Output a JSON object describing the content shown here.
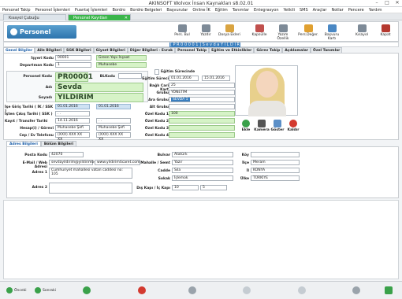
{
  "window": {
    "title": "AKINSOFT Wolvox İnsan Kaynakları s8.02.01",
    "min": "–",
    "max": "□",
    "close": "✕"
  },
  "menu": [
    "Personel Takip",
    "Personel İşlemleri",
    "Puantaj İşlemleri",
    "Bordro",
    "Bordro Belgeleri",
    "Başvurular",
    "Online İK",
    "Eğitim",
    "Tanımlar",
    "Entegrasyon",
    "Yetkili",
    "SMS",
    "Araçlar",
    "Notlar",
    "Pencere",
    "Yardım"
  ],
  "tabs": {
    "inactive": "Kısayol Çubuğu",
    "active": "Personel Kayıtları",
    "close": "✕"
  },
  "session": {
    "company": "Şirket: 2016 - YILDIZ MARKET (01)",
    "user": "Kullanıcı: Yetkili"
  },
  "header": {
    "title": "Personel Kayıtları"
  },
  "toolbar": [
    "Pers. Bul",
    "Yazdır",
    "Dosya Ekleri",
    "Kapsülle",
    "Yazım Özellik",
    "Pers.Değer.",
    "Başvuru Kartı",
    "Kısayol",
    "Kapat"
  ],
  "code_header": "[ P R 0 0 0 0 1 ]   S e v d a   Y I L D I R I M",
  "subtabs": [
    "Genel Bilgiler",
    "Aile Bilgileri",
    "SGK Bilgileri",
    "Giyset Bilgileri",
    "Diğer Bilgileri - Evrak",
    "Personel Takip",
    "Eğitim ve Etkinlikler",
    "Görev Takip",
    "Açıklamalar",
    "Özel Tanımlar"
  ],
  "form": {
    "isyeri_kodu_label": "İşyeri Kodu",
    "isyeri_kodu": "00001",
    "isyeri_adi": "Green Yapı İnşaat",
    "departman_label": "Departman Kodu",
    "departman_kodu": "1",
    "departman_adi": "Muhasebe",
    "personel_kodu_label": "Personel Kodu",
    "personel_kodu": "PR00001",
    "blkodu_label": "BLKodu",
    "blkodu": "",
    "adi_label": "Adı",
    "adi": "Sevda",
    "soyadi_label": "Soyadı",
    "soyadi": "YILDIRIM",
    "giris_label": "İşe Giriş Tarihi ( İK / SSK )",
    "giris1": "01.01.2016",
    "giris2": "01.01.2016",
    "cikis_label": "İşten Çıkış Tarihi ( SSK )",
    "cikis": ". .",
    "kayit_label": "Kayıt / Transfer Tarihi",
    "kayit1": "14.11.2016",
    "kayit2": ". .",
    "hesap_label": "Hesap(i) / Görevi",
    "hesap": "Muhasebe Şefi",
    "gorev": "Muhasebe Şefi",
    "cep_label": "Cep / Ev Telefonu",
    "cep": "(XXX) XXX XX XX",
    "ev": "(XXX) XXX XX XX",
    "egitim_label": "Eğitim Sürecinde",
    "egitim_sureci_label": "Eğitim Süreci",
    "egitim1": "01.01.2016",
    "egitim2": "15.01.2016",
    "bagli_label": "Bağlı Cari Kart",
    "bagli": "25",
    "grubu_label": "Grubu",
    "grubu": "YÖNETİM",
    "ara_grubu_label": "Ara Grubu",
    "ara_grubu": "SEVDA 1",
    "alt_grubu_label": "Alt Grubu",
    "alt_grubu": "",
    "ozel1_label": "Özel Kodu 1",
    "ozel1": "100",
    "ozel2_label": "Özel Kodu 2",
    "ozel3_label": "Özel Kodu 3",
    "ozel4_label": "Özel Kodu 4",
    "ozel5_label": "Özel Kodu 5"
  },
  "photo_buttons": [
    "Ekle",
    "Kamera",
    "Göster",
    "Kaldır"
  ],
  "lower_tabs": [
    "Adres Bilgileri",
    "Bölüm Bilgileri"
  ],
  "address": {
    "posta_label": "Posta Kodu",
    "posta": "42070",
    "email_label": "E-Mail / Web Adresi",
    "email": "sevdayildirim@yildirimtic",
    "web": "www.yildirimticaret.com",
    "adres1_label": "Adres 1",
    "adres1": "Cumhuriyet mahallesi vatan caddesi no: 105",
    "adres2_label": "Adres 2",
    "adres2": "",
    "bulvar_label": "Bulvar",
    "bulvar": "Atatürk",
    "mahalle_label": "Mahalle / Semt",
    "mahalle": "Yazır",
    "cadde_label": "Cadde",
    "cadde": "Sıla",
    "sokak_label": "Sokak",
    "sokak": "İşlemok",
    "kapi_label": "Dış Kapı / İç Kapı",
    "dis_kapi": "10",
    "ic_kapi": "5",
    "koy_label": "Köy",
    "koy": "",
    "ilce_label": "İlçe",
    "ilce": "Meram",
    "il_label": "İl",
    "il": "KONYA",
    "ulke_label": "Ülke",
    "ulke": "TÜRKİYE"
  },
  "footer": {
    "prev": "Önceki",
    "next": "Sonraki"
  },
  "colors": {
    "accent": "#3ab54a",
    "banner": "#2d74ad",
    "green_field": "#d6f3c7"
  }
}
